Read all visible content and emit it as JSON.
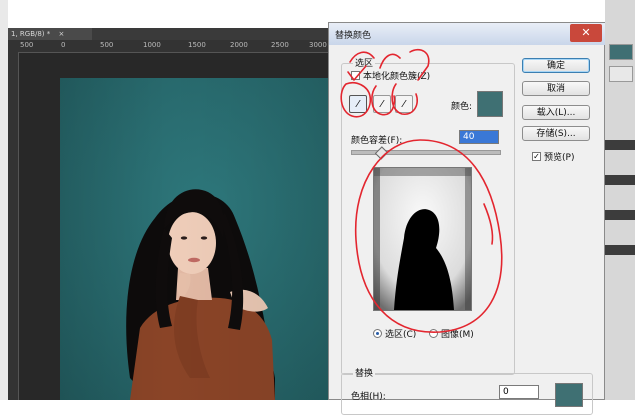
{
  "document": {
    "tab_label": "1, RGB/8) *",
    "ruler_ticks": [
      "500",
      "0",
      "500",
      "1000",
      "1500",
      "2000",
      "2500",
      "3000"
    ]
  },
  "dialog": {
    "title": "替换颜色",
    "close_glyph": "✕",
    "selection": {
      "group_label": "选区",
      "localized_clusters_label": "本地化颜色簇(Z)",
      "color_label": "颜色:",
      "color_swatch": "#3f7073",
      "fuzziness_label": "颜色容差(F):",
      "fuzziness_value": "40",
      "fuzziness_fraction": 0.2,
      "view_selection_label": "选区(C)",
      "view_image_label": "图像(M)"
    },
    "buttons": {
      "ok": "确定",
      "cancel": "取消",
      "load": "载入(L)...",
      "save": "存储(S)...",
      "preview_label": "预览(P)",
      "preview_checked": true
    },
    "replacement": {
      "group_label": "替换",
      "hue_label": "色相(H):",
      "hue_value": "0",
      "result_swatch": "#3f7073"
    }
  },
  "colors": {
    "backdrop": "#2a6f73",
    "annotation": "#e3262f"
  }
}
